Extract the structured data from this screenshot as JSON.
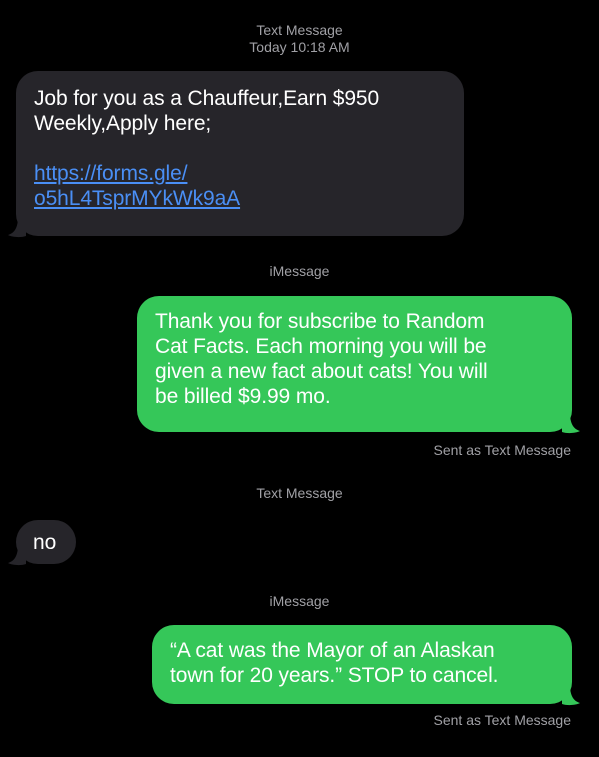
{
  "conversation": {
    "section1": {
      "label": "Text Message",
      "time": "Today 10:18 AM"
    },
    "msg1": {
      "text_line1": "Job for you as a Chauffeur,Earn $950",
      "text_line2": "Weekly,Apply here;",
      "link_line1": "https://forms.gle/",
      "link_line2": "o5hL4TsprMYkWk9aA"
    },
    "section2": {
      "label": "iMessage"
    },
    "msg2": {
      "line1": "Thank you for subscribe to Random",
      "line2": "Cat Facts. Each morning you will be",
      "line3": "given a new fact about cats! You will",
      "line4": "be billed $9.99 mo.",
      "status": "Sent as Text Message"
    },
    "section3": {
      "label": "Text Message"
    },
    "msg3": {
      "text": "no"
    },
    "section4": {
      "label": "iMessage"
    },
    "msg4": {
      "line1": "“A cat was the Mayor of an Alaskan",
      "line2": "town for 20 years.” STOP to cancel.",
      "status": "Sent as Text Message"
    }
  },
  "colors": {
    "background": "#000000",
    "incoming_bubble": "#26252a",
    "outgoing_bubble": "#35c759",
    "link": "#4a8ff5",
    "meta_text": "#a0a0a5"
  }
}
